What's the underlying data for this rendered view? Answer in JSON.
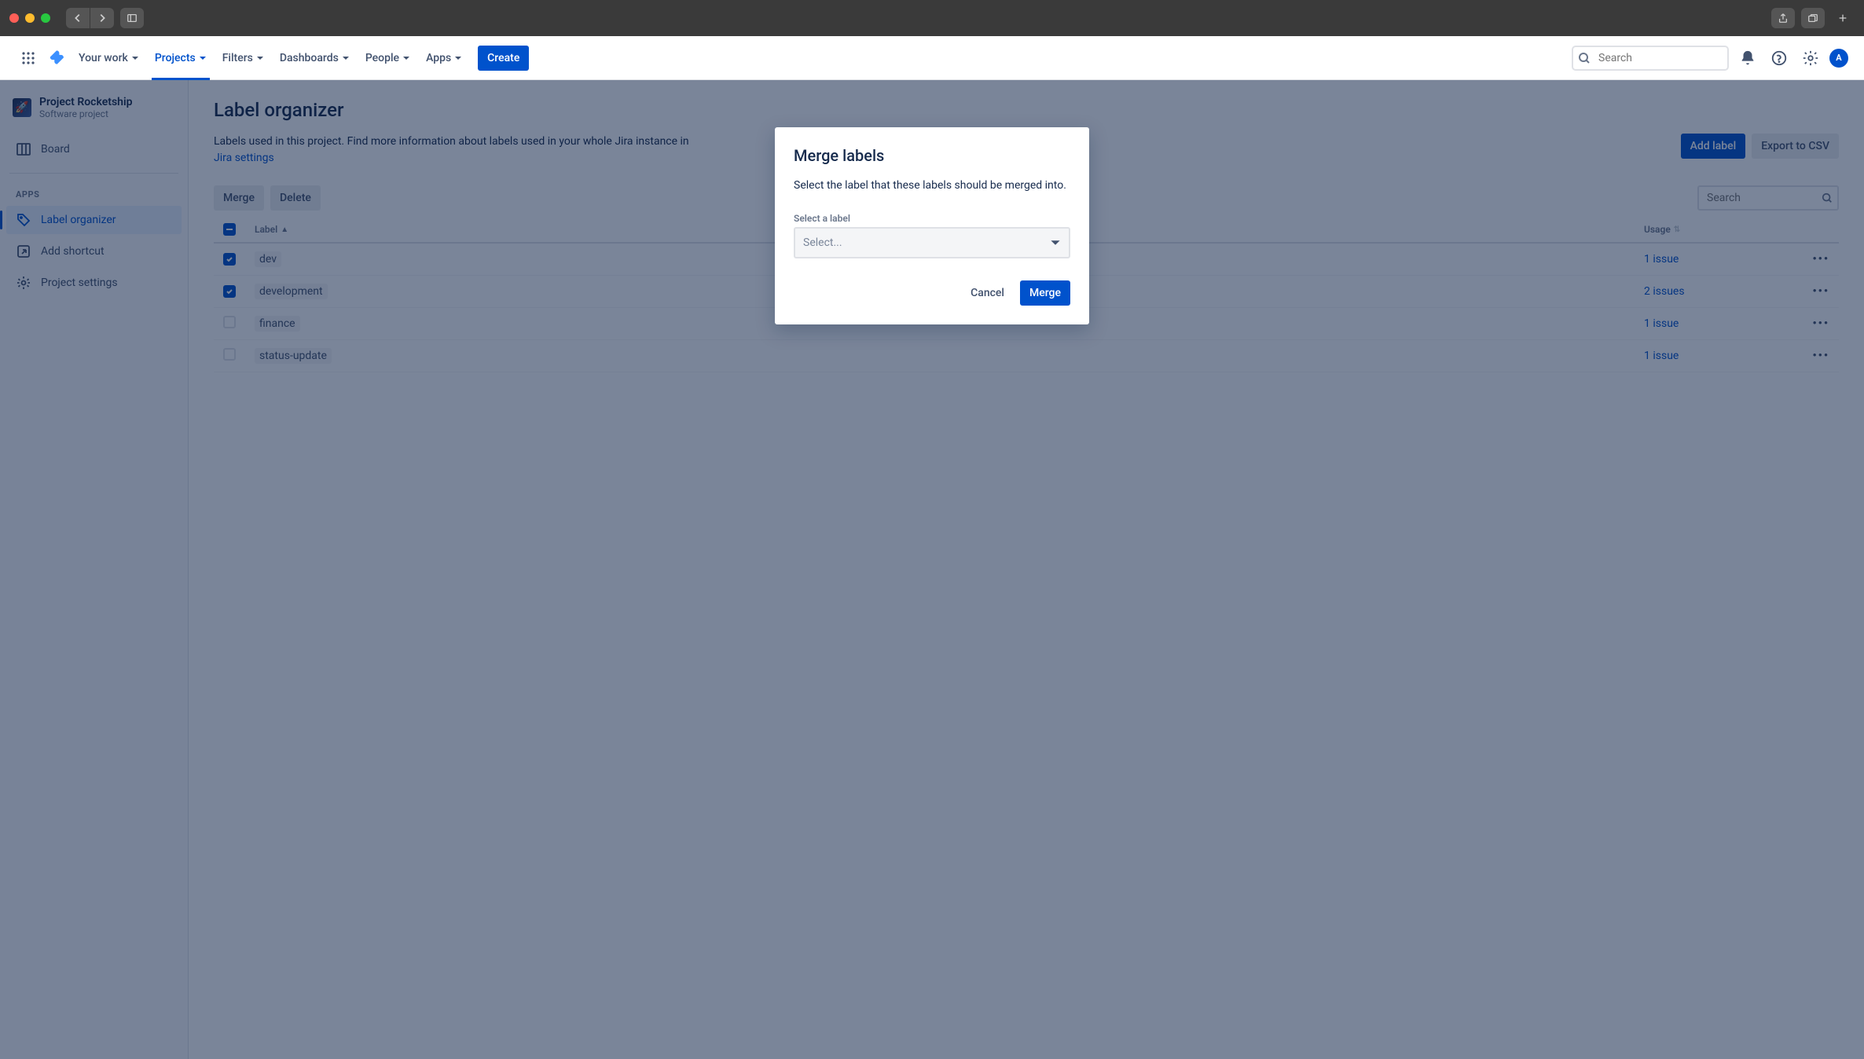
{
  "nav": {
    "your_work": "Your work",
    "projects": "Projects",
    "filters": "Filters",
    "dashboards": "Dashboards",
    "people": "People",
    "apps": "Apps",
    "create": "Create",
    "search_placeholder": "Search",
    "avatar_initial": "A"
  },
  "sidebar": {
    "project_title": "Project Rocketship",
    "project_sub": "Software project",
    "board": "Board",
    "apps_heading": "APPS",
    "label_organizer": "Label organizer",
    "add_shortcut": "Add shortcut",
    "project_settings": "Project settings"
  },
  "page": {
    "title": "Label organizer",
    "desc_prefix": "Labels used in this project. Find more information about labels used in your whole Jira instance in ",
    "desc_link": "Jira settings",
    "add_label": "Add label",
    "export_csv": "Export to CSV",
    "merge": "Merge",
    "delete": "Delete",
    "table_search_placeholder": "Search",
    "th_label": "Label",
    "th_usage": "Usage",
    "rows": [
      {
        "label": "dev",
        "usage": "1 issue",
        "checked": true
      },
      {
        "label": "development",
        "usage": "2 issues",
        "checked": true
      },
      {
        "label": "finance",
        "usage": "1 issue",
        "checked": false
      },
      {
        "label": "status-update",
        "usage": "1 issue",
        "checked": false
      }
    ]
  },
  "modal": {
    "title": "Merge labels",
    "body": "Select the label that these labels should be merged into.",
    "field_label": "Select a label",
    "select_placeholder": "Select...",
    "cancel": "Cancel",
    "merge": "Merge"
  }
}
